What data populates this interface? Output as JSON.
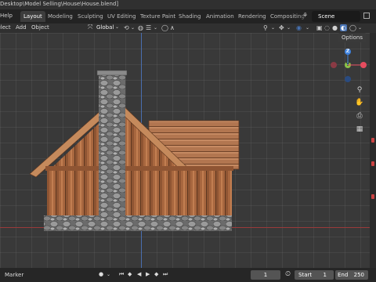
{
  "title_bar": {
    "path": "Desktop\\Model Selling\\House\\House.blend]"
  },
  "top_bar": {
    "help": "Help",
    "tabs": [
      "Layout",
      "Modeling",
      "Sculpting",
      "UV Editing",
      "Texture Paint",
      "Shading",
      "Animation",
      "Rendering",
      "Compositing"
    ],
    "active_tab": "Layout",
    "scene": "Scene"
  },
  "header": {
    "menu": [
      "Select",
      "Add",
      "Object"
    ],
    "transform_orientation": "Global"
  },
  "viewport": {
    "options_label": "Options",
    "gizmo": {
      "z": "Z",
      "y": "Y"
    }
  },
  "bottom_bar": {
    "marker": "Marker",
    "current_frame": "1",
    "start_label": "Start",
    "start_value": "1",
    "end_label": "End",
    "end_value": "250"
  },
  "colors": {
    "accent": "#4772b3",
    "axis_x": "#e74c5e",
    "axis_y": "#8ac248",
    "axis_z": "#3f83e0"
  }
}
